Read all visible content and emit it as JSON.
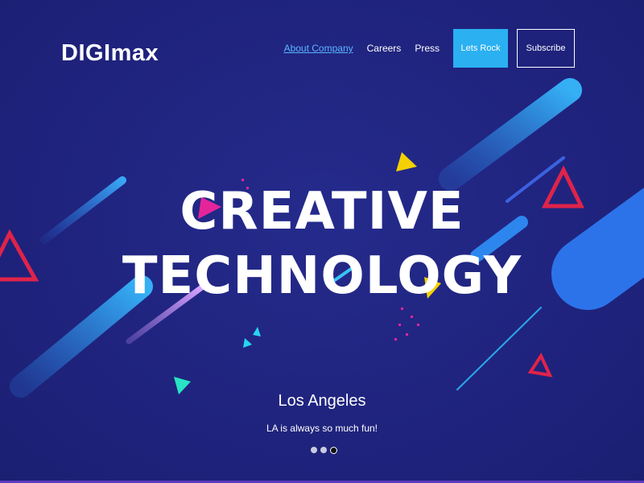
{
  "brand": {
    "logo_text": "DIGImax"
  },
  "nav": {
    "items": [
      {
        "label": "About Company",
        "active": true
      },
      {
        "label": "Careers"
      },
      {
        "label": "Press"
      }
    ],
    "primary_button": "Lets Rock",
    "secondary_button": "Subscribe"
  },
  "hero": {
    "headline_line1": "CREATIVE",
    "headline_line2": "TECHNOLOGY",
    "city": "Los Angeles",
    "tagline": "LA is always so much fun!",
    "slides": 3,
    "active_slide": 3
  },
  "colors": {
    "background": "#1f237d",
    "accent_blue": "#2bb0f2",
    "accent_red": "#e0234a",
    "accent_yellow": "#f5d000",
    "accent_pink": "#e6249a",
    "accent_teal": "#28e3c4"
  }
}
